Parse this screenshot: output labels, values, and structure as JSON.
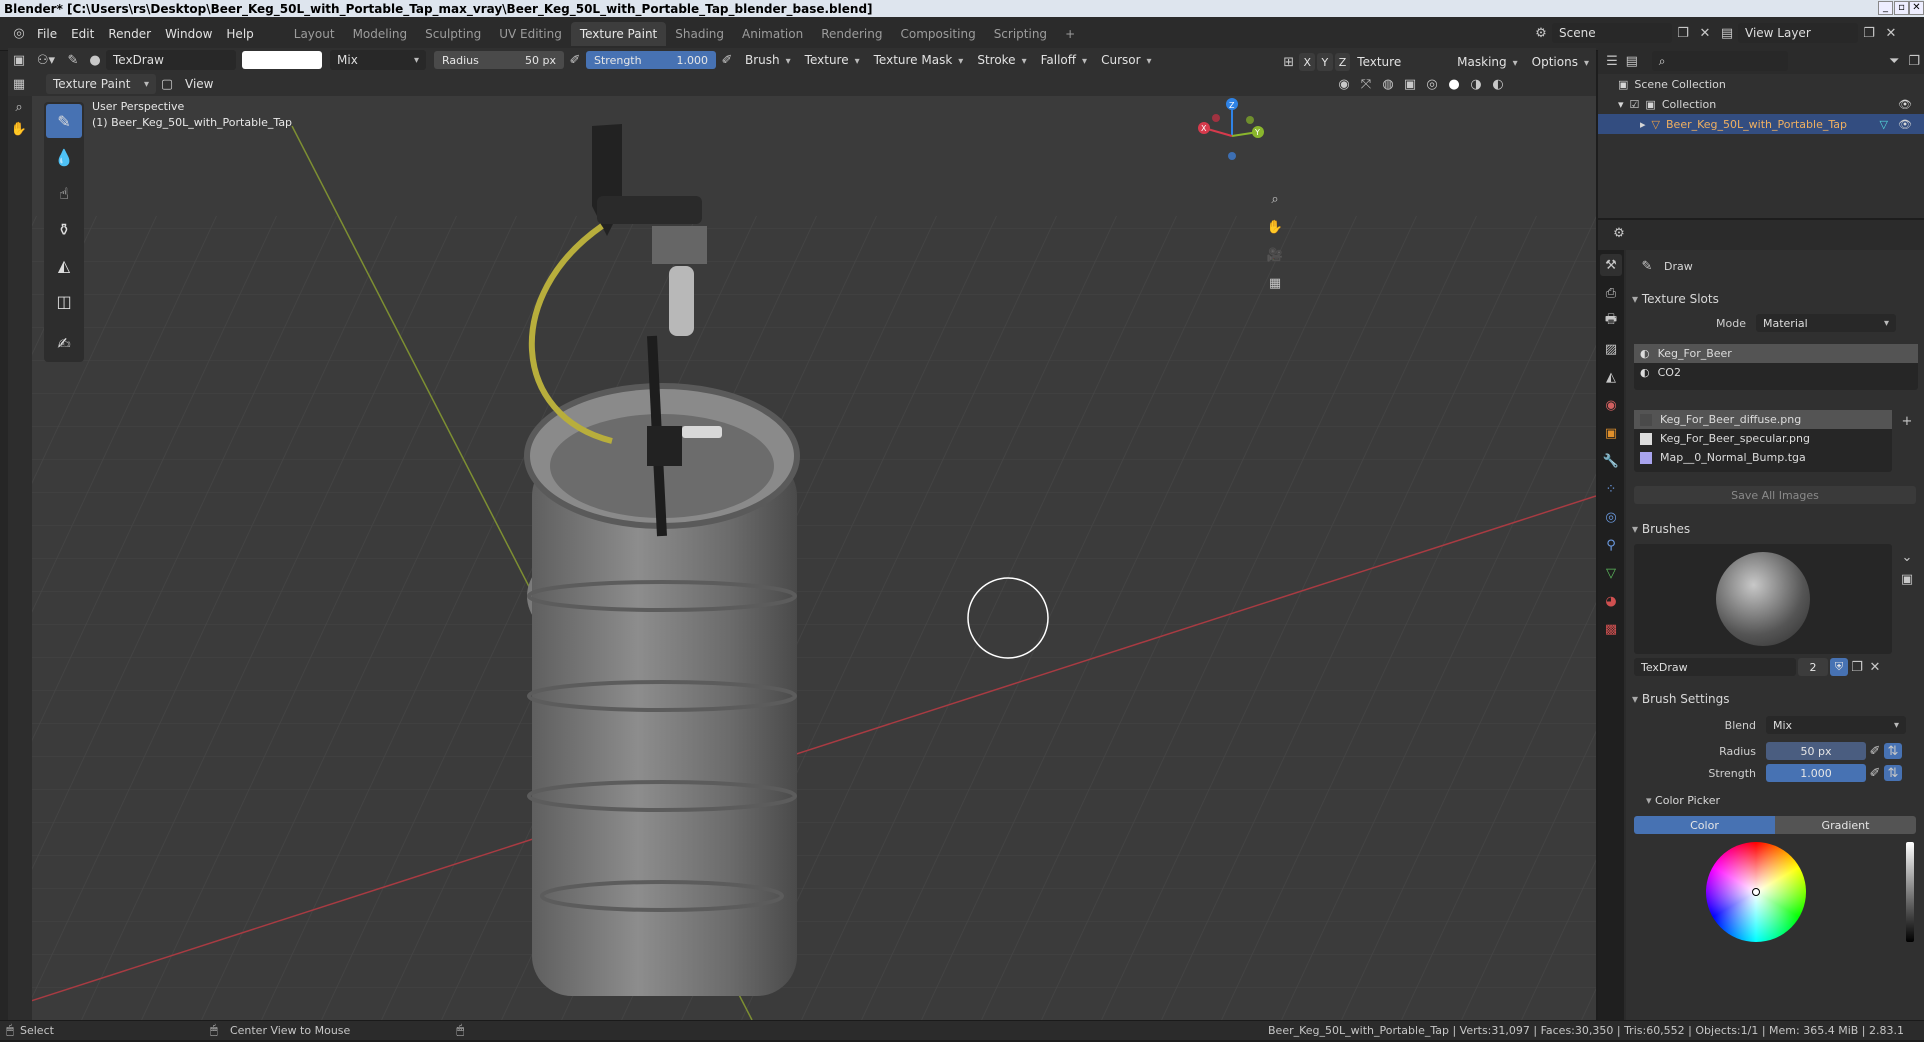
{
  "window": {
    "title": "Blender* [C:\\Users\\rs\\Desktop\\Beer_Keg_50L_with_Portable_Tap_max_vray\\Beer_Keg_50L_with_Portable_Tap_blender_base.blend]"
  },
  "menus": [
    "File",
    "Edit",
    "Render",
    "Window",
    "Help"
  ],
  "workspaces": [
    "Layout",
    "Modeling",
    "Sculpting",
    "UV Editing",
    "Texture Paint",
    "Shading",
    "Animation",
    "Rendering",
    "Compositing",
    "Scripting"
  ],
  "active_workspace": "Texture Paint",
  "scene": "Scene",
  "view_layer": "View Layer",
  "header": {
    "brush_name": "TexDraw",
    "blend_mode": "Mix",
    "radius_label": "Radius",
    "radius_value": "50 px",
    "strength_label": "Strength",
    "strength_value": "1.000",
    "menus": [
      "Brush",
      "Texture",
      "Texture Mask",
      "Stroke",
      "Falloff",
      "Cursor"
    ],
    "axes": [
      "X",
      "Y",
      "Z"
    ],
    "right_menus": [
      "Texture Slots",
      "Masking",
      "Options"
    ]
  },
  "header2": {
    "mode": "Texture Paint",
    "view": "View"
  },
  "viewport": {
    "perspective": "User Perspective",
    "object_label": "(1) Beer_Keg_50L_with_Portable_Tap",
    "axes": {
      "x": "X",
      "y": "Y",
      "z": "Z"
    }
  },
  "outliner": {
    "scene_collection": "Scene Collection",
    "collection": "Collection",
    "object": "Beer_Keg_50L_with_Portable_Tap"
  },
  "properties": {
    "tool_title": "Draw",
    "texture_slots_header": "Texture Slots",
    "mode_label": "Mode",
    "mode_value": "Material",
    "materials": [
      "Keg_For_Beer",
      "CO2"
    ],
    "images": [
      "Keg_For_Beer_diffuse.png",
      "Keg_For_Beer_specular.png",
      "Map__0_Normal_Bump.tga"
    ],
    "save_all": "Save All Images",
    "brushes_header": "Brushes",
    "brush_name": "TexDraw",
    "brush_users": "2",
    "brush_settings_header": "Brush Settings",
    "blend_label": "Blend",
    "blend_value": "Mix",
    "radius_label": "Radius",
    "radius_value": "50 px",
    "strength_label": "Strength",
    "strength_value": "1.000",
    "color_picker_header": "Color Picker",
    "tabs": [
      "Color",
      "Gradient"
    ]
  },
  "status": {
    "left": "Select",
    "middle": "Center View to Mouse",
    "right": "Beer_Keg_50L_with_Portable_Tap | Verts:31,097 | Faces:30,350 | Tris:60,552 | Objects:1/1 | Mem: 365.4 MiB | 2.83.1"
  },
  "colors": {
    "accent": "#4772b3",
    "x_axis": "#d63a4c",
    "y_axis": "#8ab62d",
    "z_axis": "#2f83e6"
  }
}
